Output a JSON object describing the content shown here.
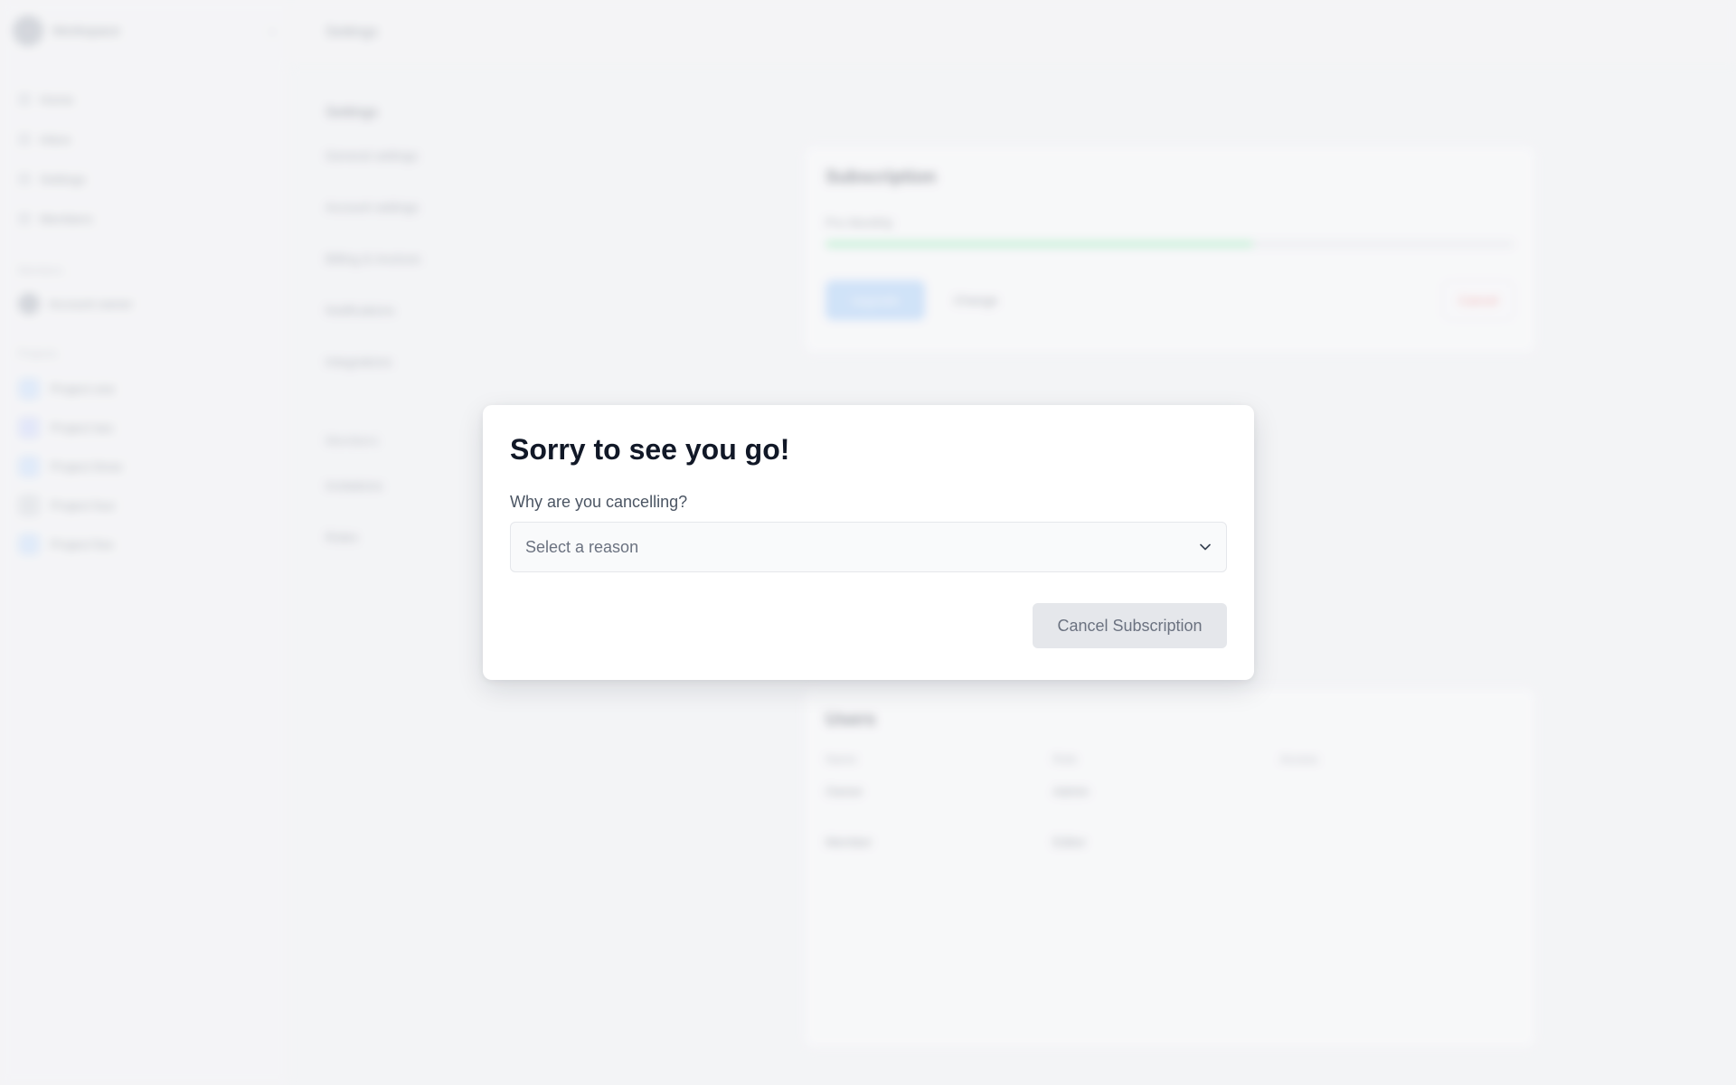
{
  "background": {
    "workspace_name": "Workspace",
    "nav": [
      "Home",
      "Inbox",
      "Settings",
      "Members"
    ],
    "section_people": "Members",
    "user_name": "Account owner",
    "section_projects": "Projects",
    "projects": [
      "Project one",
      "Project two",
      "Project three",
      "Project four",
      "Project five"
    ],
    "topbar_title": "Settings",
    "settings_title": "Settings",
    "settings_items": [
      "General settings",
      "Account settings",
      "Billing & invoices",
      "Notifications",
      "Integrations"
    ],
    "settings_section": "Members",
    "settings_items_2": [
      "Invitations",
      "Roles"
    ],
    "subscription_title": "Subscription",
    "plan_text": "Pro Monthly",
    "usage_fraction": 0.62,
    "btn_upgrade": "Upgrade",
    "btn_change": "Change",
    "btn_cancel": "Cancel",
    "members_title": "Users",
    "table_headers": [
      "Name",
      "Role",
      "Access"
    ],
    "table_rows": [
      [
        "Owner",
        "Admin",
        ""
      ],
      [
        "Member",
        "Editor",
        ""
      ]
    ]
  },
  "modal": {
    "title": "Sorry to see you go!",
    "reason_label": "Why are you cancelling?",
    "reason_placeholder": "Select a reason",
    "submit_label": "Cancel Subscription"
  },
  "colors": {
    "submit_bg": "#e5e7eb",
    "submit_text": "#6b7280",
    "select_bg": "#f9fafb"
  }
}
